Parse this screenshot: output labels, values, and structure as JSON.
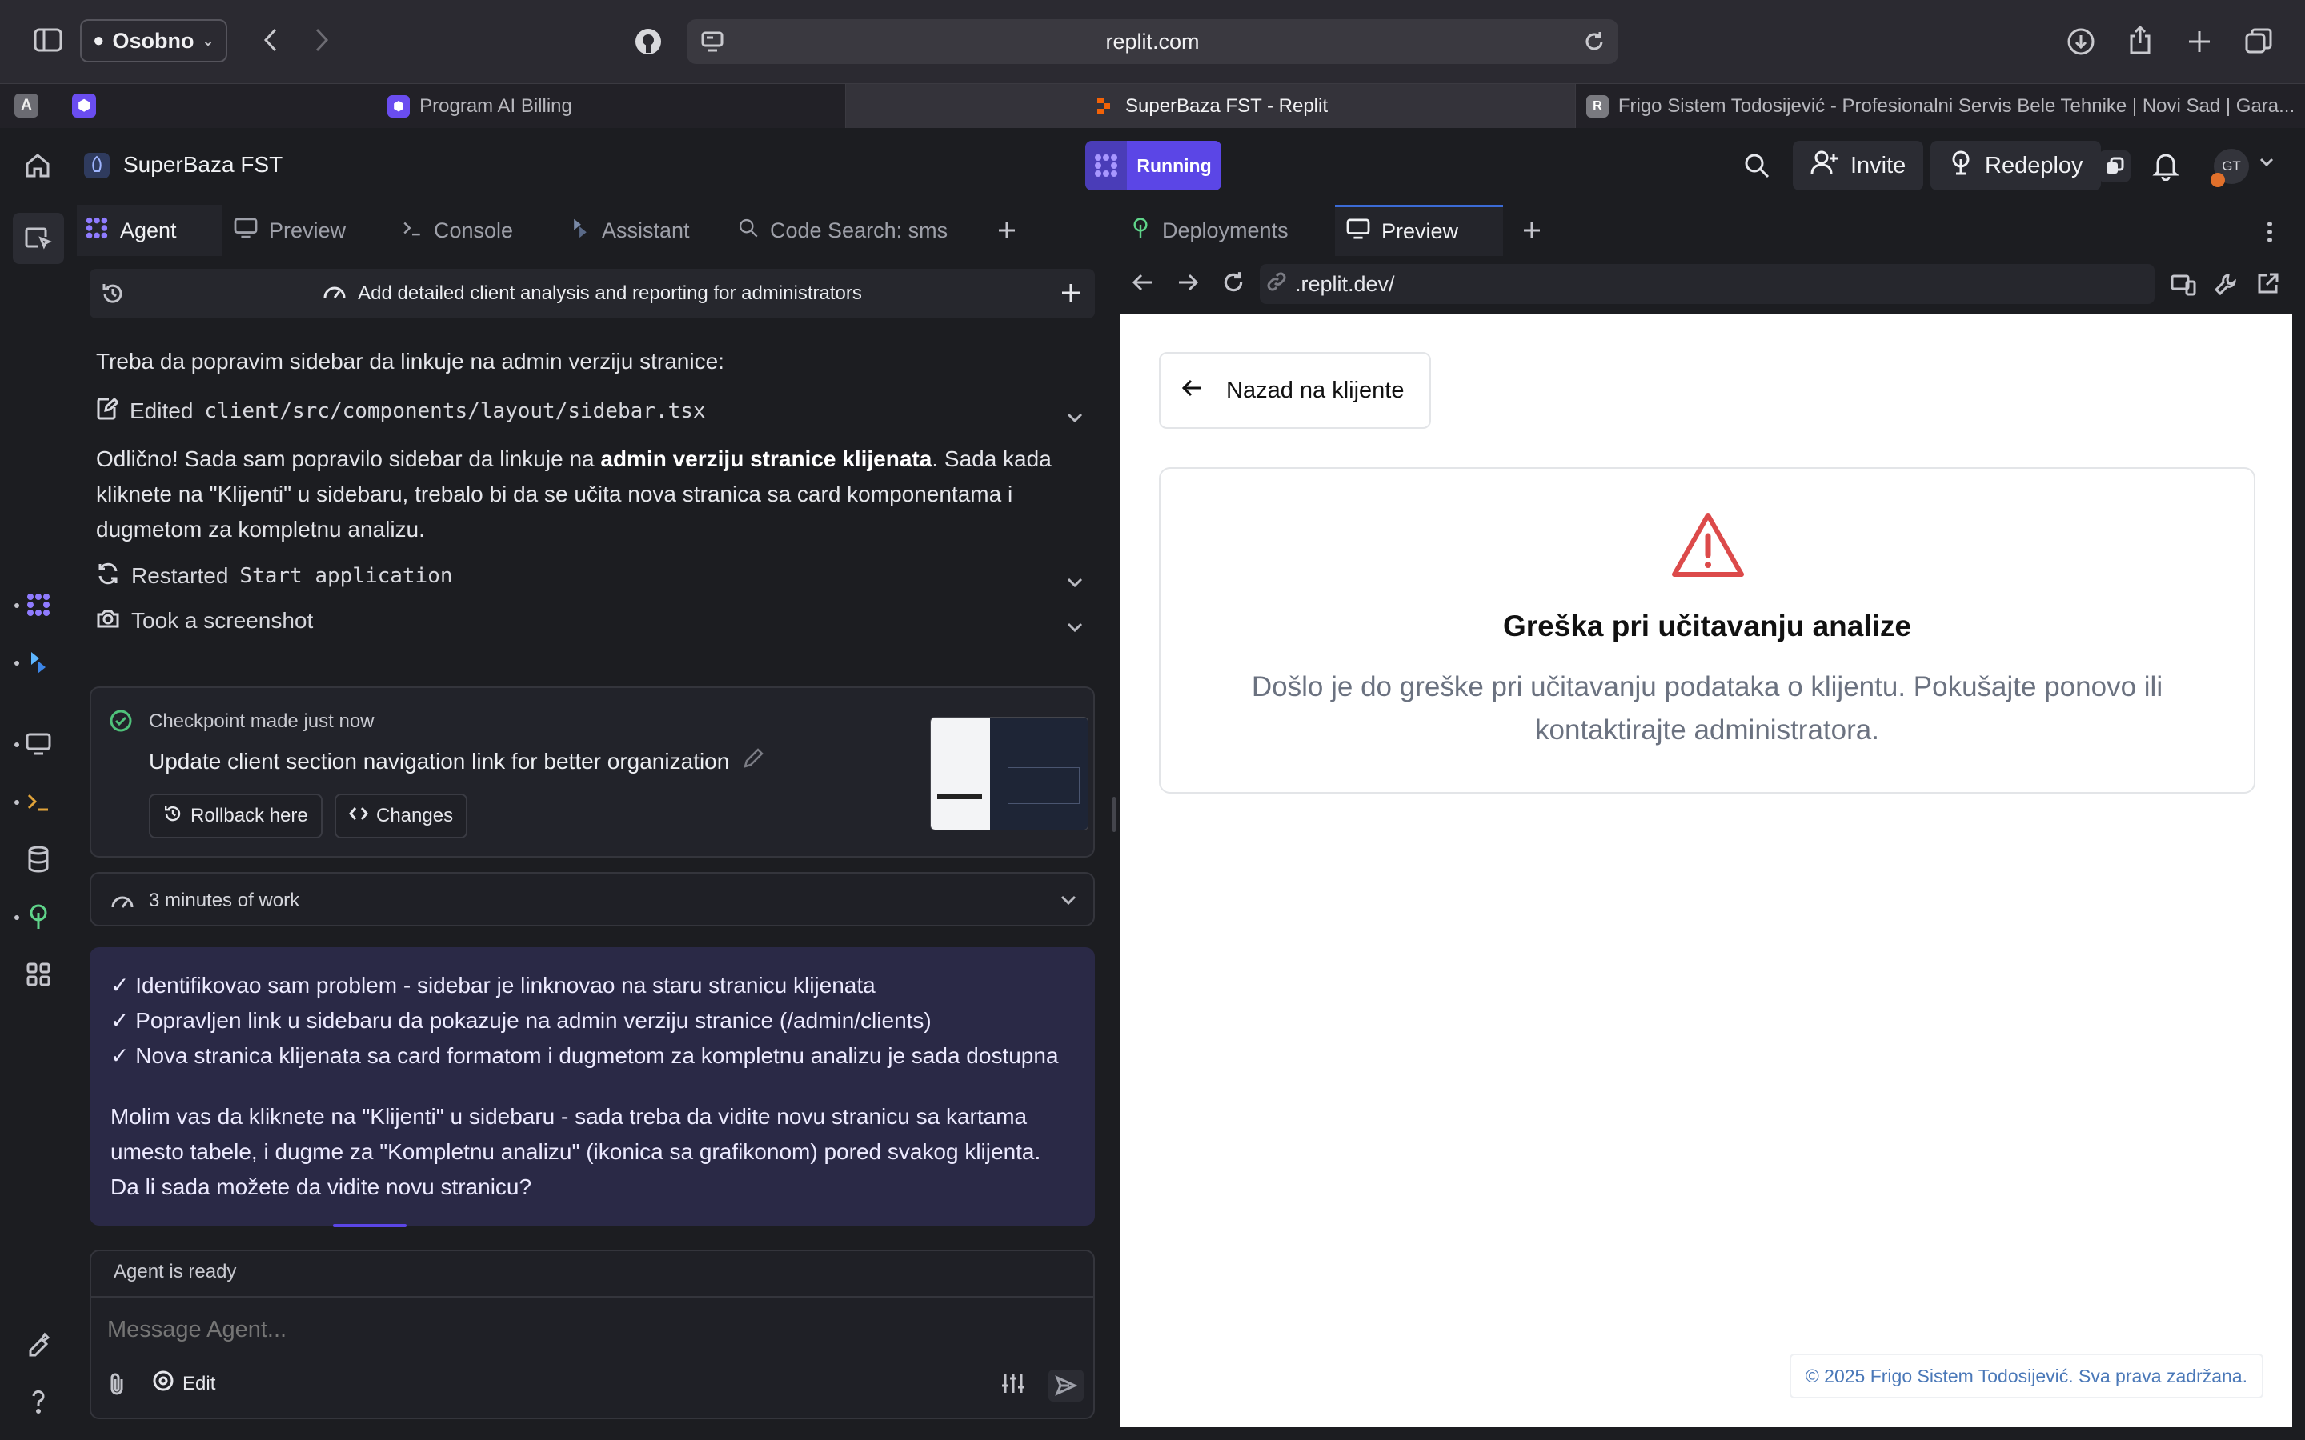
{
  "browser": {
    "profile_label": "Osobno",
    "url": "replit.com",
    "tabs": [
      {
        "title": "Program AI Billing"
      },
      {
        "title": "SuperBaza FST - Replit"
      },
      {
        "title": "Frigo Sistem Todosijević - Profesionalni Servis Bele Tehnike | Novi Sad | Gara..."
      }
    ],
    "pinned": [
      "A",
      "R"
    ]
  },
  "replit": {
    "project_name": "SuperBaza FST",
    "status": "Running",
    "invite_label": "Invite",
    "redeploy_label": "Redeploy",
    "avatar_initials": "GT"
  },
  "left_tabs": [
    {
      "label": "Agent"
    },
    {
      "label": "Preview"
    },
    {
      "label": "Console"
    },
    {
      "label": "Assistant"
    },
    {
      "label": "Code Search: sms"
    }
  ],
  "agent": {
    "task_title": "Add detailed client analysis and reporting for administrators",
    "intro": "Treba da popravim sidebar da linkuje na admin verziju stranice:",
    "edited_label": "Edited",
    "edited_file": "client/src/components/layout/sidebar.tsx",
    "msg_part1": "Odlično! Sada sam popravilo sidebar da linkuje na ",
    "msg_bold": "admin verziju stranice klijenata",
    "msg_part2": ". Sada kada kliknete na \"Klijenti\" u sidebaru, trebalo bi da se učita nova stranica sa card komponentama i dugmetom za kompletnu analizu.",
    "restarted_label": "Restarted",
    "restarted_target": "Start application",
    "screenshot_label": "Took a screenshot",
    "checkpoint": {
      "made": "Checkpoint made",
      "time": "just now",
      "title": "Update client section navigation link for better organization",
      "rollback_label": "Rollback here",
      "changes_label": "Changes"
    },
    "work_time": "3 minutes of work",
    "summary_lines": [
      "✓ Identifikovao sam problem - sidebar je linknovao na staru stranicu klijenata",
      "✓ Popravljen link u sidebaru da pokazuje na admin verziju stranice (/admin/clients)",
      "✓ Nova stranica klijenata sa card formatom i dugmetom za kompletnu analizu je sada dostupna"
    ],
    "summary_question": "Molim vas da kliknete na \"Klijenti\" u sidebaru - sada treba da vidite novu stranicu sa kartama umesto tabele, i dugme za \"Kompletnu analizu\" (ikonica sa grafikonom) pored svakog klijenta. Da li sada možete da vidite novu stranicu?",
    "status": "Agent is ready",
    "input_placeholder": "Message Agent...",
    "edit_label": "Edit"
  },
  "right_tabs": [
    {
      "label": "Deployments"
    },
    {
      "label": "Preview"
    }
  ],
  "preview": {
    "address": ".replit.dev/",
    "back_label": "Nazad na klijente",
    "error_title": "Greška pri učitavanju analize",
    "error_desc": "Došlo je do greške pri učitavanju podataka o klijentu. Pokušajte ponovo ili kontaktirajte administratora.",
    "footer": "© 2025 Frigo Sistem Todosijević. Sva prava zadržana."
  },
  "colors": {
    "accent": "#5b46e6",
    "error": "#dc4a4a",
    "summary_bg": "#2a2946"
  }
}
